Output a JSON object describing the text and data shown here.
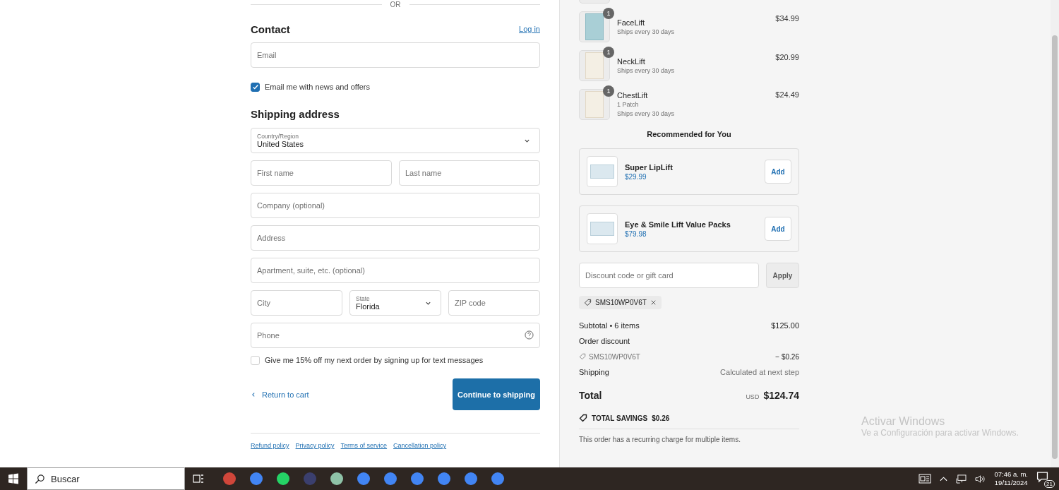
{
  "divider_label": "OR",
  "contact": {
    "heading": "Contact",
    "login_link": "Log in",
    "email": {
      "placeholder": "Email"
    },
    "newsletter": {
      "label": "Email me with news and offers",
      "checked": true
    }
  },
  "shipping": {
    "heading": "Shipping address",
    "country": {
      "label": "Country/Region",
      "value": "United States"
    },
    "first_name": {
      "placeholder": "First name"
    },
    "last_name": {
      "placeholder": "Last name"
    },
    "company": {
      "placeholder": "Company (optional)"
    },
    "address": {
      "placeholder": "Address"
    },
    "apartment": {
      "placeholder": "Apartment, suite, etc. (optional)"
    },
    "city": {
      "placeholder": "City"
    },
    "state": {
      "label": "State",
      "value": "Florida"
    },
    "zip": {
      "placeholder": "ZIP code"
    },
    "phone": {
      "placeholder": "Phone"
    },
    "sms_opt_in": {
      "label": "Give me 15% off my next order by signing up for text messages",
      "checked": false
    }
  },
  "actions": {
    "back_link": "Return to cart",
    "continue_button": "Continue to shipping"
  },
  "policies": [
    "Refund policy",
    "Privacy policy",
    "Terms of service",
    "Cancellation policy"
  ],
  "order_items": [
    {
      "name": "FaceLift",
      "quantity": "1",
      "details": [
        "Ships every 30 days"
      ],
      "price": "$34.99"
    },
    {
      "name": "NeckLift",
      "quantity": "1",
      "details": [
        "Ships every 30 days"
      ],
      "price": "$20.99"
    },
    {
      "name": "ChestLift",
      "quantity": "1",
      "details": [
        "1 Patch",
        "Ships every 30 days"
      ],
      "price": "$24.49"
    }
  ],
  "recommendations": {
    "heading": "Recommended for You",
    "products": [
      {
        "name": "Super LipLift",
        "price": "$29.99",
        "button": "Add"
      },
      {
        "name": "Eye & Smile Lift Value Packs",
        "price": "$79.98",
        "button": "Add"
      }
    ]
  },
  "discount": {
    "placeholder": "Discount code or gift card",
    "button": "Apply",
    "applied_code": "SMS10WP0V6T"
  },
  "totals": {
    "subtotal_label": "Subtotal • 6 items",
    "subtotal": "$125.00",
    "order_discount_label": "Order discount",
    "discount_code": "SMS10WP0V6T",
    "discount_amount": "− $0.26",
    "shipping_label": "Shipping",
    "shipping_value": "Calculated at next step",
    "total_label": "Total",
    "currency": "USD",
    "total": "$124.74",
    "savings_label": "TOTAL SAVINGS",
    "savings": "$0.26",
    "note": "This order has a recurring charge for multiple items."
  },
  "windows_notice": {
    "title": "Activar Windows",
    "subtitle": "Ve a Configuración para activar Windows."
  },
  "taskbar": {
    "search_placeholder": "Buscar",
    "time": "07:46 a. m.",
    "date": "19/11/2024",
    "notification_count": "21"
  }
}
